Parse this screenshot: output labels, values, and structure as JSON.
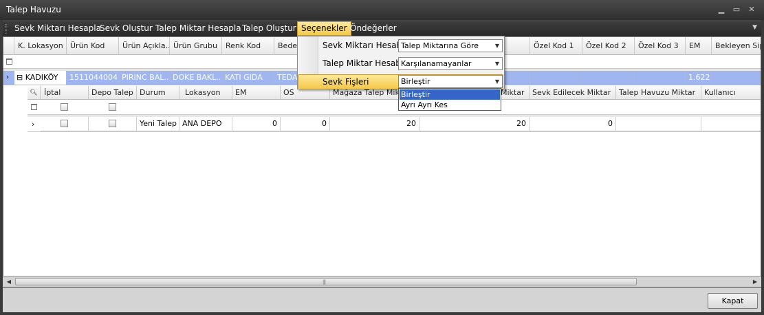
{
  "window": {
    "title": "Talep Havuzu",
    "controls": [
      "minimize-icon",
      "maximize-icon",
      "close-icon"
    ]
  },
  "menubar": {
    "items": [
      {
        "label": "Sevk Miktarı Hesapla"
      },
      {
        "label": "Sevk Oluştur"
      },
      {
        "label": "Talep Miktar Hesapla"
      },
      {
        "label": "Talep Oluştur"
      },
      {
        "label": "Seçenekler",
        "active": true
      },
      {
        "label": "Öndeğerler"
      }
    ]
  },
  "options_panel": {
    "rows": [
      {
        "label": "Sevk Miktarı Hesabı",
        "value": "Talep Miktarına Göre"
      },
      {
        "label": "Talep Miktar Hesabı",
        "value": "Karşılanamayanlar"
      },
      {
        "label": "Sevk Fişleri",
        "value": "Birleştir"
      }
    ],
    "dropdown_options": [
      "Birleştir",
      "Ayrı Ayrı Kes"
    ],
    "dropdown_selected": "Birleştir"
  },
  "master_grid": {
    "columns": [
      "K. Lokasyon",
      "Ürün Kod",
      "Ürün Açıkla...",
      "Ürün Grubu",
      "Renk Kod",
      "Beden",
      "Özel Kod 1",
      "Özel Kod 2",
      "Özel Kod 3",
      "EM",
      "Bekleyen Sipa"
    ],
    "row": {
      "expand_sign": "⊟",
      "lokasyon": "KADIKÖY",
      "urun_kod": "1511044004",
      "urun_aciklama": "PIRINC BAL...",
      "urun_grubu": "DOKE BAKL...",
      "renk_kod": "KATI GIDA",
      "beden": "TEDAR",
      "em": "1.622"
    }
  },
  "detail_grid": {
    "columns": [
      "İptal",
      "Depo Talep",
      "Durum",
      "Lokasyon",
      "EM",
      "OS",
      "Mağaza Talep Miktarı",
      "Miktar",
      "Sevk Edilecek Miktar",
      "Talep Havuzu Miktar",
      "Kullanıcı"
    ],
    "row": {
      "durum": "Yeni Talep",
      "lokasyon": "ANA DEPO",
      "em": "0",
      "os": "0",
      "magaza_talep": "20",
      "miktar": "20",
      "sevk_edilecek": "0"
    }
  },
  "footer": {
    "close_label": "Kapat"
  }
}
